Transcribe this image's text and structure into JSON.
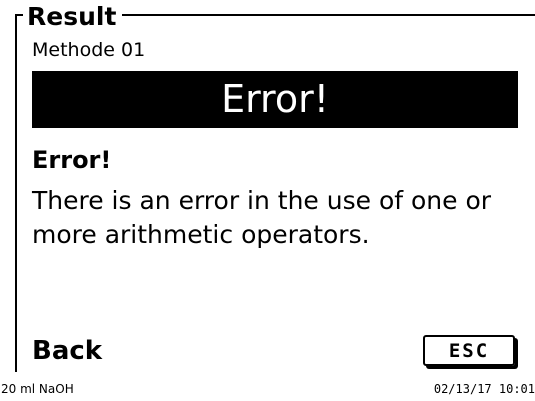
{
  "dialog": {
    "title": "Result",
    "method": "Methode 01",
    "banner": "Error!",
    "heading": "Error!",
    "message": "There is an error in the use of one or more arithmetic operators."
  },
  "footer": {
    "back_label": "Back",
    "esc_label": "ESC"
  },
  "status_bar": {
    "left": "20 ml NaOH",
    "right": "02/13/17 10:01"
  }
}
